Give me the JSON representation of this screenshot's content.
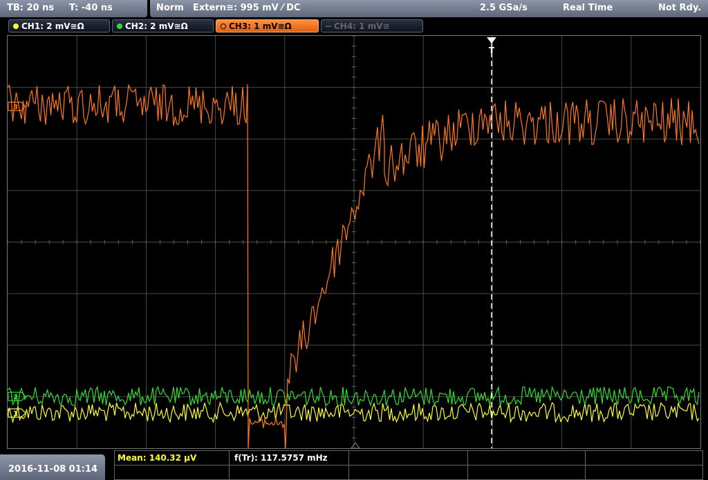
{
  "status_bar": {
    "timebase": "TB: 20 ns",
    "trigger_time": "T: -40 ns",
    "trigger_mode": "Norm",
    "trigger_source": "Extern≅: 995 mV ⁄ DC",
    "sample_rate": "2.5 GSa/s",
    "acq_mode": "Real Time",
    "state": "Not Rdy."
  },
  "channels": [
    {
      "label": "CH1: 2 mV≅Ω",
      "color": "#ffff33",
      "state": "on"
    },
    {
      "label": "CH2: 2 mV≅Ω",
      "color": "#33dd33",
      "state": "on"
    },
    {
      "label": "CH3: 1 mV≅Ω",
      "color": "#ff7a1e",
      "state": "active"
    },
    {
      "label": "CH4: 1 mV≅",
      "color": "#666666",
      "state": "off"
    }
  ],
  "markers": {
    "trigger_marker": "T",
    "ch3_marker": "3",
    "ch2_marker": "2",
    "ch1_marker": "1"
  },
  "bottom": {
    "datetime": "2016-11-08 01:14",
    "measurements": [
      {
        "label": "Mean: 140.32 µV",
        "color": "#ffff33"
      },
      {
        "label": "f(Tr): 117.5757 mHz",
        "color": "#ffffff"
      }
    ]
  },
  "colors": {
    "ch1": "#ffff33",
    "ch2": "#33dd33",
    "ch3": "#ff7a1e",
    "grid": "#4a4a4a",
    "bar": "#7a8396"
  }
}
